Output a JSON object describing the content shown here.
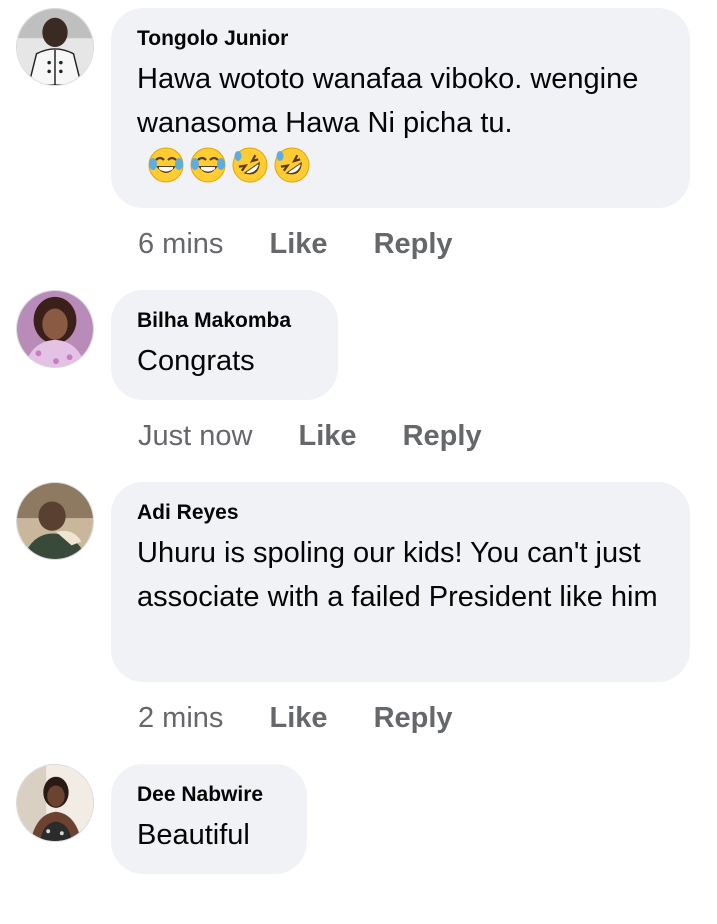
{
  "comments": [
    {
      "author": "Tongolo Junior",
      "text": "Hawa wototo wanafaa viboko. wengine wanasoma Hawa Ni picha tu.",
      "emojis": [
        "tears-of-joy-emoji",
        "tears-of-joy-emoji",
        "rolling-laughing-emoji",
        "rolling-laughing-emoji"
      ],
      "time": "6 mins",
      "like_label": "Like",
      "reply_label": "Reply"
    },
    {
      "author": "Bilha Makomba",
      "text": "Congrats",
      "time": "Just now",
      "like_label": "Like",
      "reply_label": "Reply"
    },
    {
      "author": "Adi Reyes",
      "text": "Uhuru is spoling our kids! You can't just associate with a failed President like him",
      "time": "2 mins",
      "like_label": "Like",
      "reply_label": "Reply"
    },
    {
      "author": "Dee Nabwire",
      "text": "Beautiful",
      "time": "",
      "like_label": "",
      "reply_label": ""
    }
  ],
  "colors": {
    "bubble": "#f0f2f5",
    "name": "#050505",
    "meta": "#65676b"
  }
}
